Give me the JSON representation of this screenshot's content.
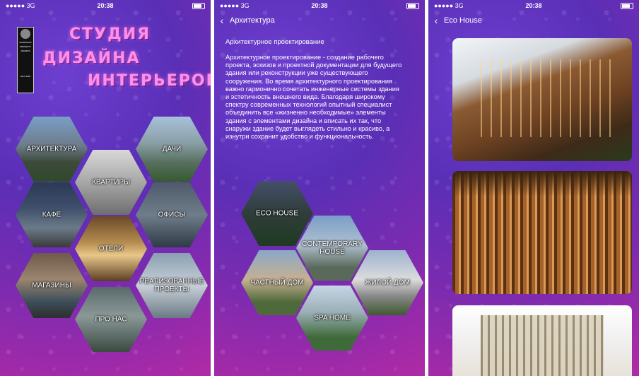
{
  "status": {
    "signal": "●●●●● 3G",
    "time": "20:38"
  },
  "home": {
    "title_line1": "СТУДИЯ",
    "title_line2": "ДИЗАЙНА",
    "title_line3": "ИНТЕРЬЕРОВ",
    "award": {
      "l1": "EUROPEAN",
      "l2": "PROPERTY",
      "l3": "AWARDS",
      "l4": "2017-2018"
    },
    "tiles": [
      "АРХИТЕКТУРА",
      "ДАЧИ",
      "КВАРТИРЫ",
      "КАФЕ",
      "ОФИСЫ",
      "ОТЕЛИ",
      "МАГАЗИНЫ",
      "РЕАЛИЗОВАННЫЕ ПРОЕКТЫ",
      "ПРО НАС"
    ]
  },
  "architecture": {
    "back_label": "Архитектура",
    "heading": "Архитектурное проектирование",
    "body": "Архитектурное проектирование - создание рабочего проекта, эскизов и проектной документации для будущего здания или реконструкции уже существующего сооружения. Во время архитектурного проектирования важно гармонично сочетать инженерные системы здания и эстетичность внешнего вида. Благодаря широкому спектру современных технологий опытный специалист объединить все «жизненно необходимые» элементы здания с элементами дизайна и вписать их так, что снаружи здание будет выглядеть стильно и красиво, а изнутри сохранит удобство и функциональность.",
    "tiles": [
      "ECO HOUSE",
      "CONTEMPORARY HOUSE",
      "ЧАСТНЫЙ ДОМ",
      "ЖИЛОЙ ДОМ",
      "SPA HOME"
    ]
  },
  "eco": {
    "back_label": "Eco House"
  }
}
